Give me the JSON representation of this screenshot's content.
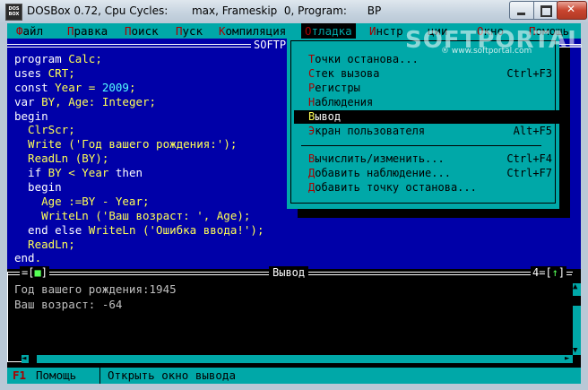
{
  "window": {
    "title": "DOSBox 0.72, Cpu Cycles:       max, Frameskip  0, Program:      BP",
    "icon_text": "DOS BOX"
  },
  "menubar": {
    "items": [
      {
        "hk": "Ф",
        "rest": "айл"
      },
      {
        "hk": "П",
        "rest": "равка"
      },
      {
        "hk": "П",
        "rest": "оиск"
      },
      {
        "hk": "П",
        "rest": "уск"
      },
      {
        "hk": "К",
        "rest": "омпиляция"
      },
      {
        "hk": "О",
        "rest": "тладка"
      },
      {
        "hk": "И",
        "rest": "нстр"
      },
      {
        "hk": "",
        "rest": "ции"
      },
      {
        "hk": "О",
        "rest": "кно"
      },
      {
        "hk": "П",
        "rest": "омощь"
      }
    ]
  },
  "editor": {
    "title": "SOFTP",
    "lines": [
      [
        {
          "t": "program ",
          "c": "kw"
        },
        {
          "t": "Calc;",
          "c": "id"
        }
      ],
      [
        {
          "t": "uses ",
          "c": "kw"
        },
        {
          "t": "CRT;",
          "c": "id"
        }
      ],
      [
        {
          "t": "const ",
          "c": "kw"
        },
        {
          "t": "Year = ",
          "c": "id"
        },
        {
          "t": "2009",
          "c": "num"
        },
        {
          "t": ";",
          "c": "id"
        }
      ],
      [
        {
          "t": "var ",
          "c": "kw"
        },
        {
          "t": "BY, Age: Integer;",
          "c": "id"
        }
      ],
      [
        {
          "t": "begin",
          "c": "kw"
        }
      ],
      [
        {
          "t": "  ClrScr;",
          "c": "id"
        }
      ],
      [
        {
          "t": "  Write (",
          "c": "id"
        },
        {
          "t": "'Год вашего рождения:'",
          "c": "str"
        },
        {
          "t": ");",
          "c": "id"
        }
      ],
      [
        {
          "t": "  ReadLn (BY);",
          "c": "id"
        }
      ],
      [
        {
          "t": "  if ",
          "c": "kw"
        },
        {
          "t": "BY < Year ",
          "c": "id"
        },
        {
          "t": "then",
          "c": "kw"
        }
      ],
      [
        {
          "t": "  begin",
          "c": "kw"
        }
      ],
      [
        {
          "t": "    Age :=BY - Year;",
          "c": "id"
        }
      ],
      [
        {
          "t": "    WriteLn (",
          "c": "id"
        },
        {
          "t": "'Ваш возраст: '",
          "c": "str"
        },
        {
          "t": ", Age);",
          "c": "id"
        }
      ],
      [
        {
          "t": "  end ",
          "c": "kw"
        },
        {
          "t": "else ",
          "c": "kw"
        },
        {
          "t": "WriteLn (",
          "c": "id"
        },
        {
          "t": "'Ошибка ввода!'",
          "c": "str"
        },
        {
          "t": ");",
          "c": "id"
        }
      ],
      [
        {
          "t": "  ReadLn;",
          "c": "id"
        }
      ],
      [
        {
          "t": "end",
          "c": "kw"
        },
        {
          "t": ".",
          "c": "id"
        }
      ]
    ]
  },
  "dropdown": {
    "items": [
      {
        "hk": "Т",
        "rest": "очки останова...",
        "shortcut": "",
        "selected": false
      },
      {
        "hk": "С",
        "rest": "тек вызова",
        "shortcut": "Ctrl+F3",
        "selected": false
      },
      {
        "hk": "Р",
        "rest": "егистры",
        "shortcut": "",
        "selected": false
      },
      {
        "hk": "Н",
        "rest": "аблюдения",
        "shortcut": "",
        "selected": false
      },
      {
        "hk": "В",
        "rest": "ывод",
        "shortcut": "",
        "selected": true
      },
      {
        "hk": "Э",
        "rest": "кран пользователя",
        "shortcut": "Alt+F5",
        "selected": false
      },
      {
        "hk": "В",
        "rest": "ычислить/изменить...",
        "shortcut": "Ctrl+F4",
        "selected": false
      },
      {
        "hk": "Д",
        "rest": "обавить наблюдение...",
        "shortcut": "Ctrl+F7",
        "selected": false
      },
      {
        "hk": "Д",
        "rest": "обавить точку останова...",
        "shortcut": "",
        "selected": false
      }
    ]
  },
  "output": {
    "title": "Вывод",
    "close_glyph": "■",
    "window_number": "4",
    "zoom_glyph": "↑",
    "lines": [
      "Год вашего рождения:1945",
      "Ваш возраст: -64"
    ]
  },
  "statusbar": {
    "key": "F1",
    "key_label": "Помощь",
    "hint": "Открыть окно вывода"
  },
  "watermark": {
    "text": "SOFTPORTAL",
    "sub": "® www.softportal.com"
  },
  "colors": {
    "dos_cyan": "#00a8a8",
    "dos_blue": "#0000a8",
    "dos_yellow": "#ffff55",
    "dos_red": "#a80000"
  }
}
